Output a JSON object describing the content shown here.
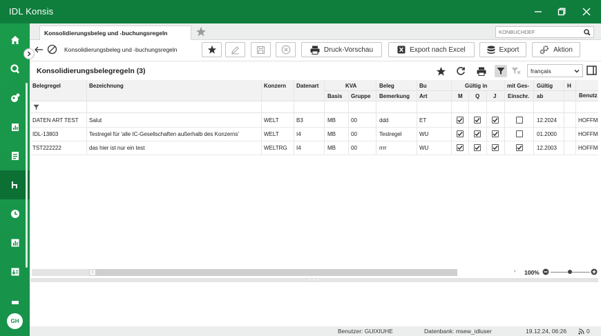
{
  "app": {
    "title": "IDL Konsis"
  },
  "tab": {
    "label": "Konsolidierungsbeleg und -buchungsregeln"
  },
  "search": {
    "placeholder": "KONBUCHDEF"
  },
  "toolbar": {
    "breadcrumb": "Konsolidierungsbeleg und -buchungsregeln",
    "print_preview_label": "Druck-Vorschau",
    "export_excel_label": "Export nach Excel",
    "export_label": "Export",
    "action_label": "Aktion"
  },
  "panel": {
    "title": "Konsolidierungsbelegregeln (3)",
    "language": "français"
  },
  "grid": {
    "headers_top": {
      "belegregel": "Belegregel",
      "bezeichnung": "Bezeichnung",
      "konzern": "Konzern",
      "datenart": "Datenart",
      "kva": "KVA",
      "beleg": "Beleg",
      "bu": "Bu",
      "gueltig_in": "Gültig in",
      "mit_ges": "mit Ges-",
      "gueltig": "Gültig",
      "h": "H",
      "benutz": "Benutz"
    },
    "headers_bottom": {
      "basis": "Basis",
      "gruppe": "Gruppe",
      "bemerkung": "Bemerkung",
      "art": "Art",
      "m": "M",
      "q": "Q",
      "j": "J",
      "einschr": "Einschr.",
      "ab": "ab"
    },
    "rows": [
      {
        "belegregel": "DATEN ART TEST",
        "bezeichnung": "Salut",
        "konzern": "WELT",
        "datenart": "B3",
        "basis": "MB",
        "gruppe": "00",
        "bemerkung": "ddd",
        "art": "ET",
        "m": true,
        "q": true,
        "j": true,
        "einschr": false,
        "ab": "12.2024",
        "benutz": "HOFFM"
      },
      {
        "belegregel": "IDL-13803",
        "bezeichnung": "Testregel für 'alle IC-Gesellschaften außerhalb des Konzerns'",
        "konzern": "WELT",
        "datenart": "I4",
        "basis": "MB",
        "gruppe": "00",
        "bemerkung": "Testregel",
        "art": "WU",
        "m": true,
        "q": true,
        "j": true,
        "einschr": false,
        "ab": "01.2000",
        "benutz": "HOFFM"
      },
      {
        "belegregel": "TST222222",
        "bezeichnung": "das hier ist nur ein test",
        "konzern": "WELTRG",
        "datenart": "I4",
        "basis": "MB",
        "gruppe": "00",
        "bemerkung": "rrrr",
        "art": "WU",
        "m": true,
        "q": true,
        "j": true,
        "einschr": true,
        "ab": "12.2003",
        "benutz": "HOFFM"
      }
    ]
  },
  "zoom": {
    "level": "100%"
  },
  "status": {
    "user": "Benutzer: GUIXIUHE",
    "database": "Datenbank: msew_idluser",
    "datetime": "19.12.24, 06:26",
    "notifications": "0"
  },
  "user_avatar": {
    "initials": "GH"
  },
  "colors": {
    "brand_green": "#17924a",
    "title_green": "#0f7d3c"
  },
  "icons": [
    "home-icon",
    "search-icon",
    "globe-icon",
    "report-icon",
    "document-icon",
    "hierarchy-icon",
    "clock-icon",
    "chart-icon",
    "import-icon"
  ]
}
